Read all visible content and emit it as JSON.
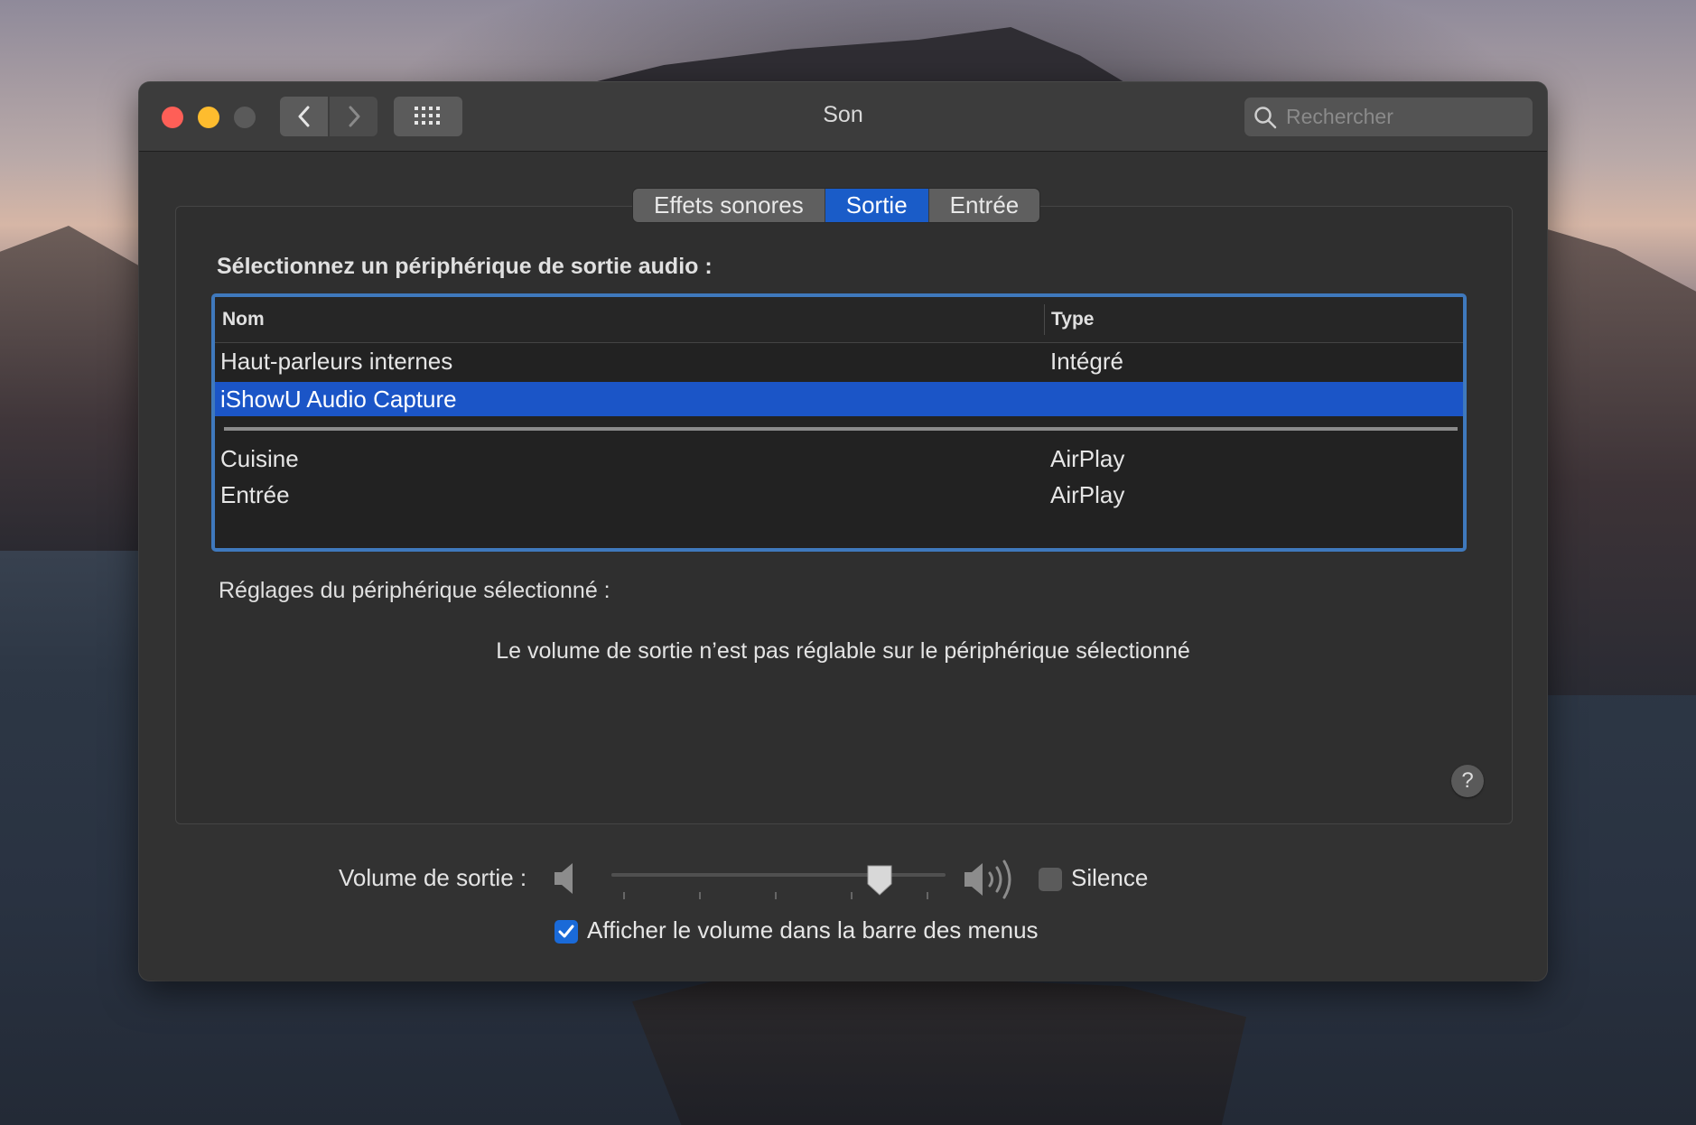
{
  "window": {
    "title": "Son",
    "search_placeholder": "Rechercher"
  },
  "tabs": [
    {
      "label": "Effets sonores",
      "active": false
    },
    {
      "label": "Sortie",
      "active": true
    },
    {
      "label": "Entrée",
      "active": false
    }
  ],
  "output": {
    "select_label": "Sélectionnez un périphérique de sortie audio :",
    "columns": {
      "name": "Nom",
      "type": "Type"
    },
    "devices": [
      {
        "name": "Haut-parleurs internes",
        "type": "Intégré",
        "selected": false
      },
      {
        "name": "iShowU Audio Capture",
        "type": "",
        "selected": true
      },
      {
        "name": "Cuisine",
        "type": "AirPlay",
        "selected": false
      },
      {
        "name": "Entrée",
        "type": "AirPlay",
        "selected": false
      }
    ],
    "settings_label": "Réglages du périphérique sélectionné :",
    "volume_message": "Le volume de sortie n’est pas réglable sur le périphérique sélectionné"
  },
  "volume": {
    "label": "Volume de sortie :",
    "level": 0.85,
    "mute_label": "Silence",
    "mute_checked": false,
    "show_in_menubar_label": "Afficher le volume dans la barre des menus",
    "show_in_menubar_checked": true
  },
  "help": {
    "label": "?"
  },
  "icons": {
    "back": "chevron-left-icon",
    "forward": "chevron-right-icon",
    "grid": "grid-icon",
    "search": "search-icon",
    "speaker_low": "speaker-low-icon",
    "speaker_high": "speaker-high-icon",
    "check": "checkmark-icon"
  },
  "colors": {
    "accent": "#1b55c7",
    "close": "#fe5f57",
    "minimize": "#febc2e",
    "table_border": "#3f79bd"
  }
}
